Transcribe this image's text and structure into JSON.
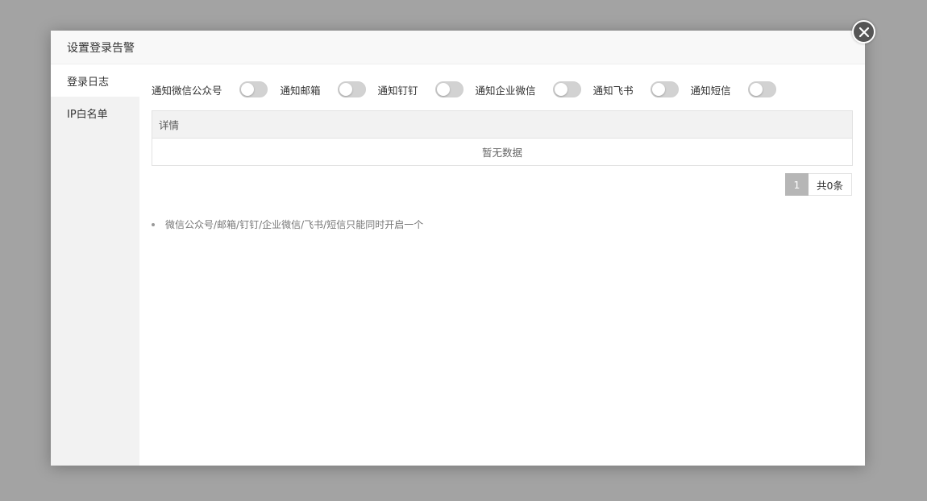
{
  "dialog": {
    "title": "设置登录告警"
  },
  "sidebar": {
    "items": [
      {
        "label": "登录日志"
      },
      {
        "label": "IP白名单"
      }
    ]
  },
  "toggles": [
    {
      "label": "通知微信公众号",
      "on": false
    },
    {
      "label": "通知邮箱",
      "on": false
    },
    {
      "label": "通知钉钉",
      "on": false
    },
    {
      "label": "通知企业微信",
      "on": false
    },
    {
      "label": "通知飞书",
      "on": false
    },
    {
      "label": "通知短信",
      "on": false
    }
  ],
  "table": {
    "header": "详情",
    "empty_text": "暂无数据"
  },
  "pagination": {
    "current_page": "1",
    "total": "共0条"
  },
  "notes": [
    "微信公众号/邮箱/钉钉/企业微信/飞书/短信只能同时开启一个"
  ],
  "colors": {
    "overlay": "#a3a3a3",
    "header_bg": "#f8f8f8",
    "sidebar_bg": "#f2f2f2",
    "switch_off": "#d2d2d2",
    "page_active": "#b6b6b6"
  }
}
